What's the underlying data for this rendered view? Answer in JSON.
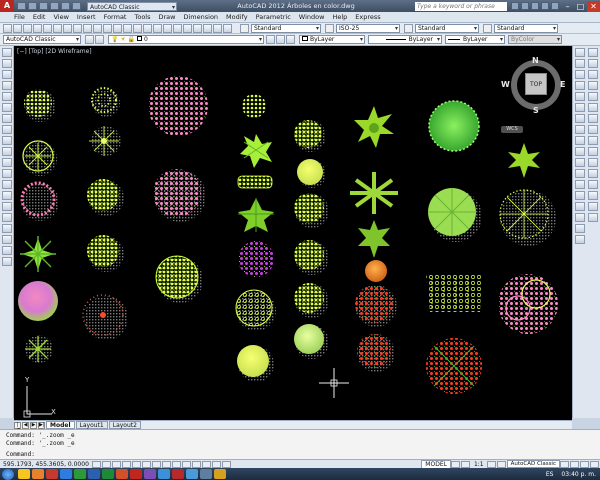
{
  "app": {
    "title": "AutoCAD 2012   Árboles en color.dwg",
    "workspace": "AutoCAD Classic",
    "search_placeholder": "Type a keyword or phrase",
    "logo_letter": "A"
  },
  "menu": [
    "File",
    "Edit",
    "View",
    "Insert",
    "Format",
    "Tools",
    "Draw",
    "Dimension",
    "Modify",
    "Parametric",
    "Window",
    "Help",
    "Express"
  ],
  "styles_toolbar": {
    "text_style": "Standard",
    "dim_style": "ISO-25",
    "table_style": "Standard",
    "mleader_style": "Standard"
  },
  "props_toolbar": {
    "workspace": "AutoCAD Classic",
    "layer": "0",
    "color": "ByLayer",
    "linetype": "ByLayer",
    "lineweight": "ByLayer",
    "plotstyle": "ByColor"
  },
  "viewport": {
    "label": "[−] [Top] [2D Wireframe]",
    "viewcube": {
      "face": "TOP",
      "north": "N",
      "south": "S",
      "east": "E",
      "west": "W",
      "wcs": "WCS"
    },
    "ucs": {
      "x": "X",
      "y": "Y"
    }
  },
  "layout_tabs": [
    "Model",
    "Layout1",
    "Layout2"
  ],
  "active_tab": "Model",
  "command_lines": [
    "Command: '_.zoom _e",
    "Command: '_.zoom _e"
  ],
  "command_prompt": "Command:",
  "status": {
    "coords": "595.1793, 455.3605, 0.0000",
    "model": "MODEL",
    "scale": "1:1",
    "workspace": "AutoCAD Classic"
  },
  "taskbar": {
    "lang": "ES",
    "clock": "03:40 p. m."
  },
  "colors": {
    "viewport_bg": "#000000",
    "titlebar": "#3e4e63",
    "accent": "#b8261f"
  }
}
